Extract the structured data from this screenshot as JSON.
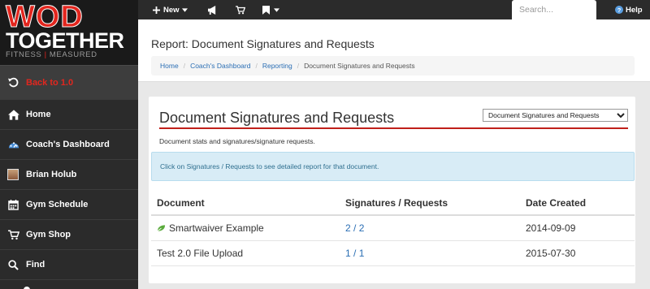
{
  "logo": {
    "line1": "WOD",
    "line2": "TOGETHER",
    "tagline_left": "FITNESS",
    "tagline_sep": "|",
    "tagline_right": "MEASURED"
  },
  "sidebar": {
    "items": [
      {
        "label": "Back to 1.0",
        "icon": "undo-icon"
      },
      {
        "label": "Home",
        "icon": "home-icon"
      },
      {
        "label": "Coach's Dashboard",
        "icon": "dashboard-icon"
      },
      {
        "label": "Brian Holub",
        "icon": "avatar"
      },
      {
        "label": "Gym Schedule",
        "icon": "calendar-icon"
      },
      {
        "label": "Gym Shop",
        "icon": "cart-icon"
      },
      {
        "label": "Find",
        "icon": "search-icon"
      }
    ]
  },
  "topbar": {
    "new_label": "New",
    "search_placeholder": "Search...",
    "help_label": "Help"
  },
  "page": {
    "title": "Report: Document Signatures and Requests",
    "breadcrumb": [
      "Home",
      "Coach's Dashboard",
      "Reporting",
      "Document Signatures and Requests"
    ]
  },
  "card": {
    "title": "Document Signatures and Requests",
    "select_value": "Document Signatures and Requests",
    "description": "Document stats and signatures/signature requests.",
    "alert": "Click on Signatures / Requests to see detailed report for that document."
  },
  "table": {
    "headers": [
      "Document",
      "Signatures / Requests",
      "Date Created"
    ],
    "rows": [
      {
        "document": "Smartwaiver Example",
        "signatures": "2",
        "requests": "2",
        "date": "2014-09-09"
      },
      {
        "document": "Test 2.0 File Upload",
        "signatures": "1",
        "requests": "1",
        "date": "2015-07-30"
      }
    ]
  },
  "colors": {
    "brand_red": "#e3261e",
    "sidebar_bg": "#2b2b2b",
    "link_blue": "#2a6eb4",
    "alert_bg": "#d8ecf6"
  }
}
